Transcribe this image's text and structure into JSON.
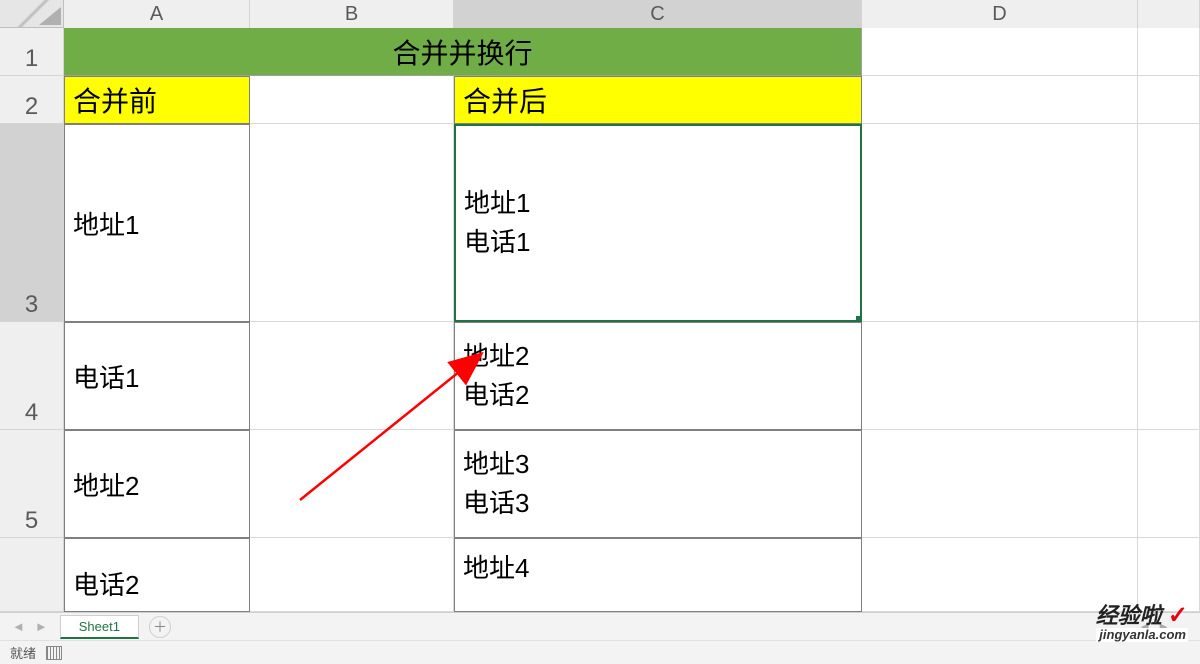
{
  "columns": [
    "A",
    "B",
    "C",
    "D"
  ],
  "rows": [
    "1",
    "2",
    "3",
    "4",
    "5"
  ],
  "title": "合并并换行",
  "headers": {
    "before": "合并前",
    "after": "合并后"
  },
  "colA": {
    "r3": "地址1",
    "r4": "电话1",
    "r5": "地址2",
    "r6": "电话2"
  },
  "colC": {
    "r3": {
      "l1": "地址1",
      "l2": "电话1"
    },
    "r4": {
      "l1": "地址2",
      "l2": "电话2"
    },
    "r5": {
      "l1": "地址3",
      "l2": "电话3"
    },
    "r6": {
      "l1": "地址4"
    }
  },
  "tabs": {
    "sheet1": "Sheet1"
  },
  "status": {
    "ready": "就绪"
  },
  "watermark": {
    "top": "经验啦",
    "check": "✓",
    "bottom": "jingyanla.com"
  },
  "chart_data": {
    "type": "table",
    "title": "合并并换行",
    "columns": [
      "合并前",
      "合并后"
    ],
    "rows": [
      {
        "合并前": "地址1",
        "合并后": "地址1\n电话1"
      },
      {
        "合并前": "电话1",
        "合并后": "地址2\n电话2"
      },
      {
        "合并前": "地址2",
        "合并后": "地址3\n电话3"
      },
      {
        "合并前": "电话2",
        "合并后": "地址4"
      }
    ]
  }
}
